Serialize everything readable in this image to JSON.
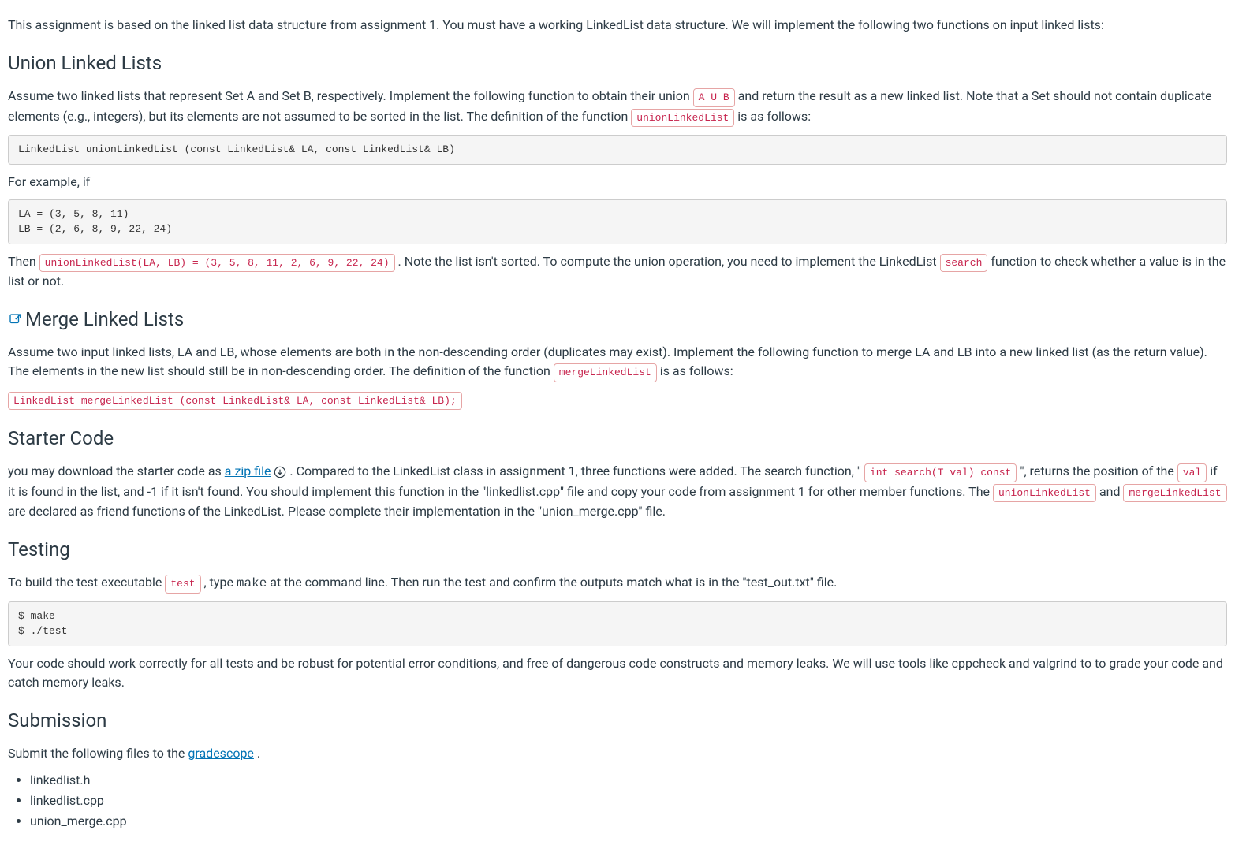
{
  "intro": "This assignment is based on the linked list data structure from assignment 1. You must have a working LinkedList data structure. We will implement the following two functions on input linked lists:",
  "union": {
    "heading": "Union Linked Lists",
    "p1a": "Assume two linked lists that represent Set A and Set B, respectively. Implement the following function to obtain their union ",
    "code_aub": "A U B",
    "p1b": " and return the result as a new linked list. Note that a Set should not contain duplicate elements (e.g., integers), but its elements are not assumed to be sorted in the list. The definition of the function ",
    "code_union": "unionLinkedList",
    "p1c": " is as follows:",
    "codeblock": "LinkedList unionLinkedList (const LinkedList& LA, const LinkedList& LB)",
    "example_intro": "For example, if",
    "example_block": "LA = (3, 5, 8, 11)\nLB = (2, 6, 8, 9, 22, 24)",
    "then_a": "Then ",
    "code_result": "unionLinkedList(LA, LB) = (3, 5, 8, 11, 2, 6, 9, 22, 24)",
    "then_b": ". Note the list isn't sorted. To compute the union operation, you need to implement the LinkedList ",
    "code_search": "search",
    "then_c": " function to check whether a value is in the list or not."
  },
  "merge": {
    "heading": "Merge Linked Lists",
    "p1a": "Assume two input linked lists, LA and LB, whose elements are both in the non-descending order (duplicates may exist). Implement the following function to merge LA and LB into a new linked list (as the return value). The elements in the new list should still be in non-descending order. The definition of the function ",
    "code_merge": "mergeLinkedList",
    "p1b": " is as follows:",
    "code_decl": "LinkedList mergeLinkedList (const LinkedList& LA, const LinkedList& LB);"
  },
  "starter": {
    "heading": "Starter Code",
    "p1a": "you may download the starter code as",
    "link_text": " a zip file",
    "p1b": " . Compared to the LinkedList class in assignment 1, three functions were added. The search function, \"",
    "code_search_sig": "int search(T val) const",
    "p1c": "\", returns the position of the ",
    "code_val": "val",
    "p1d": " if it is found in the list, and -1 if it isn't found. You should implement this function in the \"linkedlist.cpp\" file and copy your code from assignment 1 for other member functions. The ",
    "code_union": "unionLinkedList",
    "p1e": " and ",
    "code_merge": "mergeLinkedList",
    "p1f": " are declared as friend functions of the LinkedList. Please complete their implementation in the \"union_merge.cpp\" file."
  },
  "testing": {
    "heading": "Testing",
    "p1a": "To build the test executable ",
    "code_test": "test",
    "p1b": ", type ",
    "code_make": "make",
    "p1c": " at the command line. Then run the test and confirm the outputs match what is in the \"test_out.txt\" file.",
    "codeblock": "$ make\n$ ./test",
    "p2": "Your code should work correctly for all tests and be robust for potential error conditions, and free of dangerous code constructs and memory leaks. We will use tools like cppcheck and valgrind to to grade your code and catch memory leaks."
  },
  "submission": {
    "heading": "Submission",
    "p1a": "Submit the following files to the ",
    "link_text": "gradescope",
    "p1b": ".",
    "files": [
      "linkedlist.h",
      "linkedlist.cpp",
      "union_merge.cpp"
    ]
  }
}
